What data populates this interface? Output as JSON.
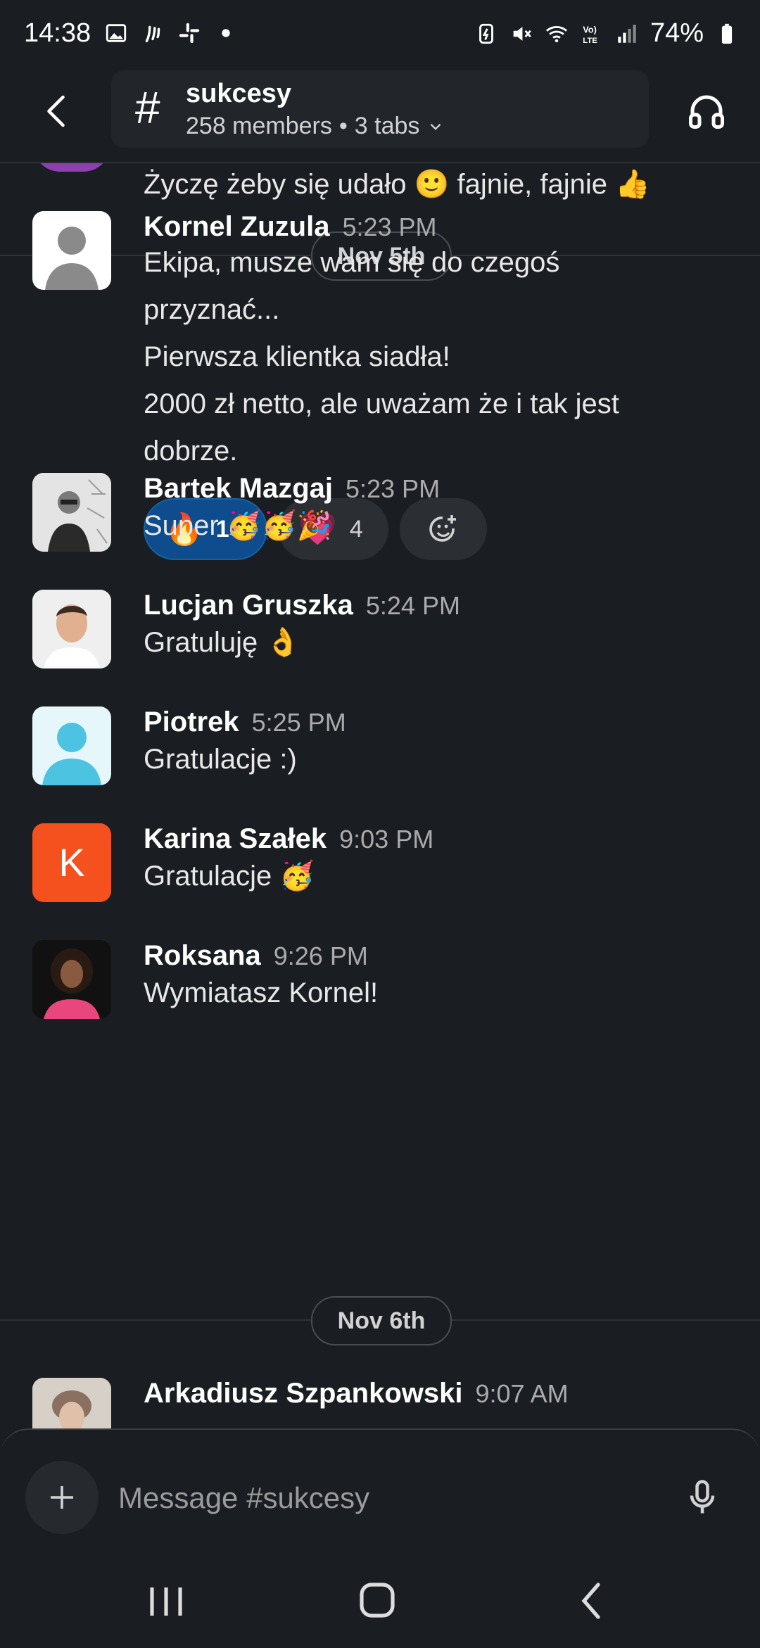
{
  "status_bar": {
    "time": "14:38",
    "battery": "74%"
  },
  "header": {
    "channel_name": "sukcesy",
    "members": "258 members",
    "separator": "•",
    "tabs": "3 tabs"
  },
  "prev_message": {
    "text": "Życzę żeby się udało 🙂 fajnie, fajnie 👍"
  },
  "dates": {
    "first": "Nov 5th",
    "second": "Nov 6th"
  },
  "messages": [
    {
      "name": "Kornel Zuzula",
      "time": "5:23 PM",
      "lines": [
        "Ekipa, musze wam się do czegoś",
        "przyznać...",
        "Pierwsza klientka siadła!",
        "2000 zł netto, ale uważam że i tak jest",
        "dobrze."
      ],
      "reactions": [
        {
          "emoji": "🔥",
          "count": "16"
        },
        {
          "emoji": "💗",
          "count": "4"
        }
      ]
    },
    {
      "name": "Bartek Mazgaj",
      "time": "5:23 PM",
      "text": "Super 🥳🥳🎉"
    },
    {
      "name": "Lucjan Gruszka",
      "time": "5:24 PM",
      "text": "Gratuluję 👌"
    },
    {
      "name": "Piotrek",
      "time": "5:25 PM",
      "text": "Gratulacje :)"
    },
    {
      "name": "Karina Szałek",
      "time": "9:03 PM",
      "text": "Gratulacje 🥳",
      "initial": "K"
    },
    {
      "name": "Roksana",
      "time": "9:26 PM",
      "text": "Wymiatasz Kornel!"
    },
    {
      "name": "Arkadiusz Szpankowski",
      "time": "9:07 AM"
    }
  ],
  "composer": {
    "placeholder": "Message #sukcesy"
  },
  "colors": {
    "background": "#1a1d21",
    "active_reaction": "#0e4c8e",
    "karina_avatar": "#f4511e",
    "piotrek_avatar": "#4cc3e0"
  },
  "icons": [
    "back-arrow-icon",
    "hash-icon",
    "chevron-down-icon",
    "headphones-icon",
    "add-reaction-icon",
    "plus-icon",
    "microphone-icon",
    "recents-icon",
    "home-icon",
    "nav-back-icon"
  ]
}
